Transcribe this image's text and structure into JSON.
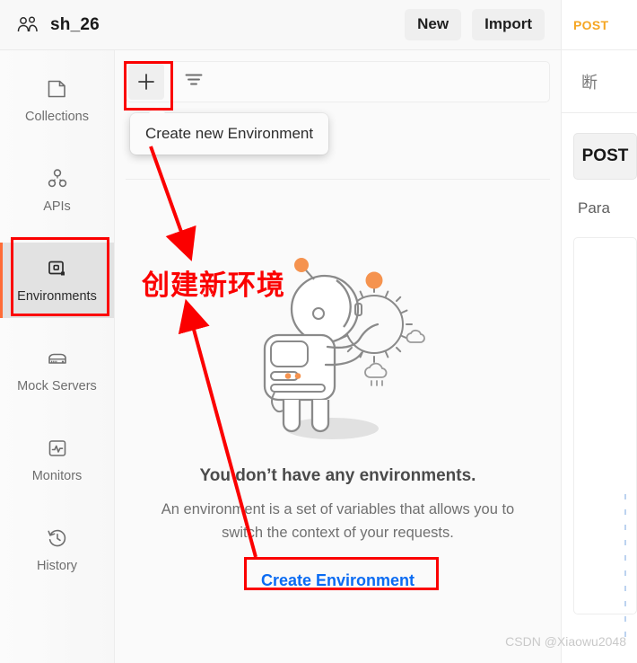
{
  "header": {
    "team_icon": "people-icon",
    "team_name": "sh_26",
    "new_label": "New",
    "import_label": "Import"
  },
  "sidebar": {
    "items": [
      {
        "label": "Collections",
        "icon": "collections-icon",
        "active": false
      },
      {
        "label": "APIs",
        "icon": "apis-icon",
        "active": false
      },
      {
        "label": "Environments",
        "icon": "environments-icon",
        "active": true
      },
      {
        "label": "Mock Servers",
        "icon": "mock-servers-icon",
        "active": false
      },
      {
        "label": "Monitors",
        "icon": "monitors-icon",
        "active": false
      },
      {
        "label": "History",
        "icon": "history-icon",
        "active": false
      }
    ]
  },
  "env_pane": {
    "create_button_icon": "plus-icon",
    "filter_icon": "filter-icon",
    "tooltip": "Create new Environment",
    "empty_title": "You don’t have any environments.",
    "empty_description": "An environment is a set of variables that allows you to switch the context of your requests.",
    "create_link": "Create Environment",
    "illustration": "astronaut-illustration"
  },
  "right_pane": {
    "tab_method": "POST",
    "breadcrumb": "断",
    "method_button": "POST",
    "params_tab": "Para"
  },
  "annotations": {
    "chinese_note": "创建新环境",
    "highlight_color": "#fb0000",
    "accent_color": "#ff6c37",
    "link_color": "#0b6bf2"
  },
  "watermark": "CSDN @Xiaowu2048"
}
